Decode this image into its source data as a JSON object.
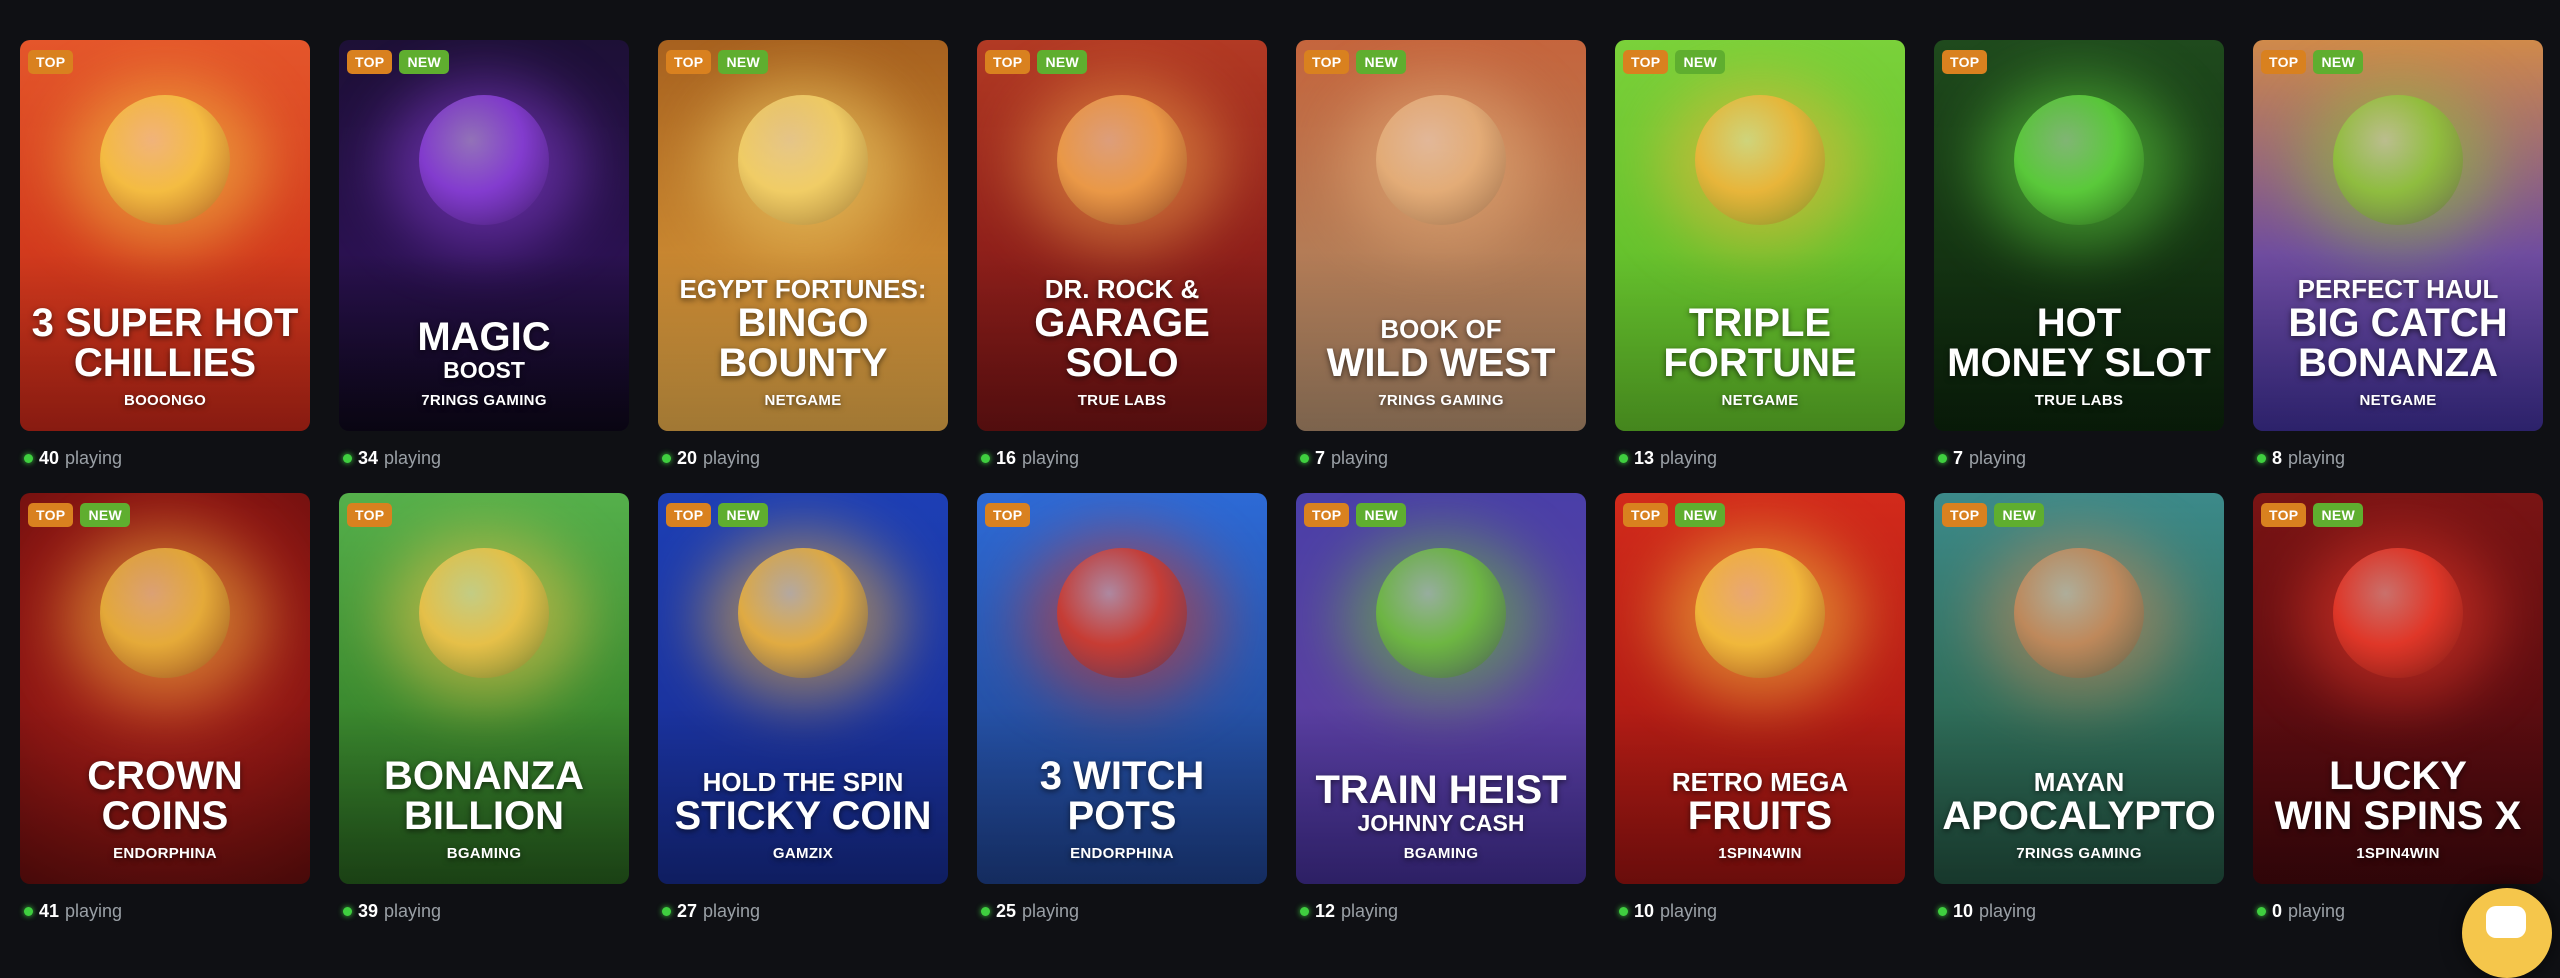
{
  "labels": {
    "top": "TOP",
    "new": "NEW",
    "playing": "playing"
  },
  "games": [
    {
      "badges": [
        "top"
      ],
      "small": "",
      "big": "3 SUPER HOT",
      "big2": "CHILLIES",
      "sub": "",
      "provider": "BOOONGO",
      "playing": "40",
      "bg": "linear-gradient(180deg,#e4562b 0%,#d23a1d 55%,#b52416 100%)",
      "accent": "#f6c544"
    },
    {
      "badges": [
        "top",
        "new"
      ],
      "small": "",
      "big": "MAGIC",
      "big2": "",
      "sub": "BOOST",
      "provider": "7RINGS GAMING",
      "playing": "34",
      "bg": "linear-gradient(180deg,#1d1036 0%,#2a1150 55%,#0c0718 100%)",
      "accent": "#8a3fd9"
    },
    {
      "badges": [
        "top",
        "new"
      ],
      "small": "EGYPT FORTUNES:",
      "big": "BINGO",
      "big2": "BOUNTY",
      "sub": "",
      "provider": "NETGAME",
      "playing": "20",
      "bg": "linear-gradient(180deg,#a7611f 0%,#c88630 55%,#d7a045 100%)",
      "accent": "#f4d36a"
    },
    {
      "badges": [
        "top",
        "new"
      ],
      "small": "DR. ROCK &",
      "big": "GARAGE",
      "big2": "SOLO",
      "sub": "",
      "provider": "TRUE LABS",
      "playing": "16",
      "bg": "linear-gradient(180deg,#b23a24 0%,#8e1f1a 55%,#6d1213 100%)",
      "accent": "#f0a14a"
    },
    {
      "badges": [
        "top",
        "new"
      ],
      "small": "BOOK OF",
      "big": "WILD WEST",
      "big2": "",
      "sub": "",
      "provider": "7RINGS GAMING",
      "playing": "7",
      "bg": "linear-gradient(180deg,#c5653d 0%,#b47c56 55%,#a58466 100%)",
      "accent": "#e6b07a"
    },
    {
      "badges": [
        "top",
        "new"
      ],
      "small": "",
      "big": "TRIPLE",
      "big2": "FORTUNE",
      "sub": "",
      "provider": "NETGAME",
      "playing": "13",
      "bg": "linear-gradient(180deg,#7ad13a 0%,#66c22d 55%,#5bb227 100%)",
      "accent": "#f1b43b"
    },
    {
      "badges": [
        "top"
      ],
      "small": "",
      "big": "HOT",
      "big2": "MONEY SLOT",
      "sub": "",
      "provider": "TRUE LABS",
      "playing": "7",
      "bg": "linear-gradient(180deg,#1f4a1d 0%,#143412 55%,#0b220b 100%)",
      "accent": "#5fd43d"
    },
    {
      "badges": [
        "top",
        "new"
      ],
      "small": "PERFECT HAUL",
      "big": "BIG CATCH",
      "big2": "BONANZA",
      "sub": "",
      "provider": "NETGAME",
      "playing": "8",
      "bg": "linear-gradient(180deg,#d08a4a 0%,#6f4ca0 55%,#3b2d8e 100%)",
      "accent": "#8fc43a"
    },
    {
      "badges": [
        "top",
        "new"
      ],
      "small": "",
      "big": "CROWN",
      "big2": "COINS",
      "sub": "",
      "provider": "ENDORPHINA",
      "playing": "41",
      "bg": "radial-gradient(circle at 50% 40%,#b5281e 0%,#8c1613 55%,#5e0c0c 100%)",
      "accent": "#e9b43b"
    },
    {
      "badges": [
        "top"
      ],
      "small": "",
      "big": "BONANZA",
      "big2": "BILLION",
      "sub": "",
      "provider": "BGAMING",
      "playing": "39",
      "bg": "linear-gradient(180deg,#55b04b 0%,#3b8a2f 55%,#23561b 100%)",
      "accent": "#f2c34a"
    },
    {
      "badges": [
        "top",
        "new"
      ],
      "small": "HOLD THE SPIN",
      "big": "STICKY COIN",
      "big2": "",
      "sub": "",
      "provider": "GAMZIX",
      "playing": "27",
      "bg": "linear-gradient(180deg,#1d3fb5 0%,#1a33a0 55%,#142780 100%)",
      "accent": "#f0b43a"
    },
    {
      "badges": [
        "top"
      ],
      "small": "",
      "big": "3 WITCH",
      "big2": "POTS",
      "sub": "",
      "provider": "ENDORPHINA",
      "playing": "25",
      "bg": "linear-gradient(180deg,#2d6ad6 0%,#2552a8 55%,#1b3a7e 100%)",
      "accent": "#d33a2a"
    },
    {
      "badges": [
        "top",
        "new"
      ],
      "small": "",
      "big": "TRAIN HEIST",
      "big2": "",
      "sub": "JOHNNY CASH",
      "provider": "BGAMING",
      "playing": "12",
      "bg": "linear-gradient(180deg,#4a3fa8 0%,#5a3fa2 55%,#3c2a86 100%)",
      "accent": "#6fbf3b"
    },
    {
      "badges": [
        "top",
        "new"
      ],
      "small": "RETRO MEGA",
      "big": "FRUITS",
      "big2": "",
      "sub": "",
      "provider": "1SPIN4WIN",
      "playing": "10",
      "bg": "linear-gradient(180deg,#d22a1b 0%,#b51d15 55%,#8d110f 100%)",
      "accent": "#f4c33e"
    },
    {
      "badges": [
        "top",
        "new"
      ],
      "small": "MAYAN",
      "big": "APOCALYPTO",
      "big2": "",
      "sub": "",
      "provider": "7RINGS GAMING",
      "playing": "10",
      "bg": "linear-gradient(180deg,#3c8a8a 0%,#2f6e5a 55%,#1f4a3a 100%)",
      "accent": "#c98a5a"
    },
    {
      "badges": [
        "top",
        "new"
      ],
      "small": "",
      "big": "LUCKY",
      "big2": "WIN SPINS X",
      "sub": "",
      "provider": "1SPIN4WIN",
      "playing": "0",
      "bg": "linear-gradient(180deg,#7a1414 0%,#5c0c10 55%,#3e070b 100%)",
      "accent": "#e93a2a"
    }
  ]
}
